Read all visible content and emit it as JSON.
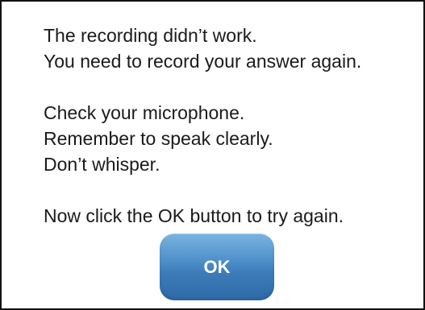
{
  "message": {
    "lines": [
      "The recording didn’t work.",
      "You need to record your answer again.",
      "",
      "Check your microphone.",
      "Remember to speak clearly.",
      "Don’t whisper.",
      "",
      "Now click the OK button to try again."
    ]
  },
  "button": {
    "ok_label": "OK"
  },
  "colors": {
    "button_top": "#7ab4e0",
    "button_bottom": "#2d6aa8",
    "text": "#1a1a1a",
    "border": "#111111"
  }
}
